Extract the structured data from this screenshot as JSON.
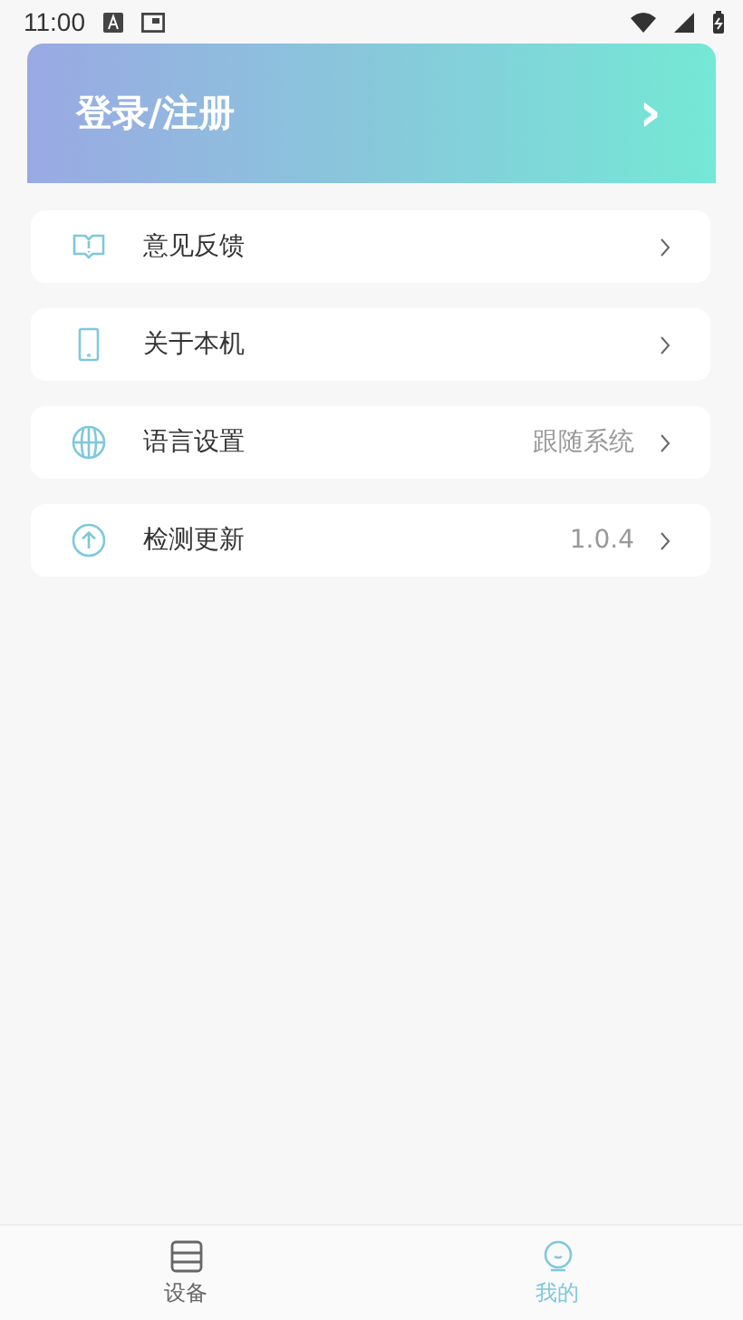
{
  "status_bar": {
    "time": "11:00"
  },
  "login": {
    "label": "登录/注册",
    "chevron": "›"
  },
  "menu": [
    {
      "label": "意见反馈"
    },
    {
      "label": "关于本机"
    },
    {
      "label": "语言设置",
      "value": "跟随系统"
    },
    {
      "label": "检测更新",
      "value": "1.0.4"
    }
  ],
  "tabs": [
    {
      "label": "设备",
      "selected": false
    },
    {
      "label": "我的",
      "selected": true
    }
  ]
}
